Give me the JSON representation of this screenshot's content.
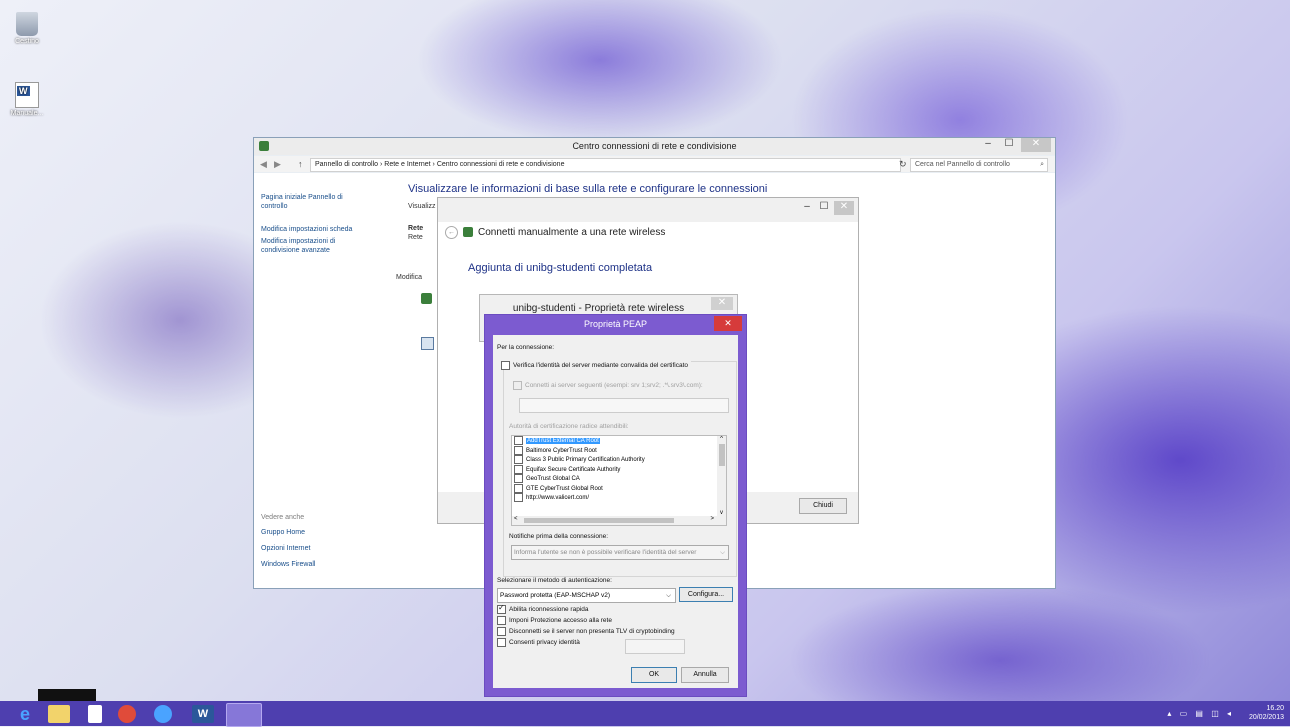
{
  "desktop": {
    "icons": [
      {
        "label": "Cestino"
      },
      {
        "label": "Manuale..."
      }
    ]
  },
  "main_window": {
    "title": "Centro connessioni di rete e condivisione",
    "breadcrumb": [
      "Pannello di controllo",
      "Rete e Internet",
      "Centro connessioni di rete e condivisione"
    ],
    "search_placeholder": "Cerca nel Pannello di controllo",
    "left_links": [
      "Pagina iniziale Pannello di controllo",
      "Modifica impostazioni scheda",
      "Modifica impostazioni di condivisione avanzate"
    ],
    "see_also_label": "Vedere anche",
    "see_also": [
      "Gruppo Home",
      "Opzioni Internet",
      "Windows Firewall"
    ],
    "heading": "Visualizzare le informazioni di base sulla rete e configurare le connessioni",
    "visualizza": "Visualizz",
    "rete_bold": "Rete",
    "rete": "Rete",
    "modifica": "Modifica"
  },
  "wireless_window": {
    "title": "Connetti manualmente a una rete wireless",
    "message": "Aggiunta di unibg-studenti completata",
    "close_button": "Chiudi"
  },
  "props_window": {
    "title": "unibg-studenti - Proprietà rete wireless"
  },
  "peap": {
    "title": "Proprietà PEAP",
    "connection_label": "Per la connessione:",
    "verify_label": "Verifica l'identità del server mediante convalida del certificato",
    "connect_servers_label": "Connetti ai server seguenti (esempi: srv 1;srv2; .*\\.srv3\\.com):",
    "ca_label": "Autorità di certificazione radice attendibili:",
    "ca_list": [
      "AddTrust External CA Root",
      "Baltimore CyberTrust Root",
      "Class 3 Public Primary Certification Authority",
      "Equifax Secure Certificate Authority",
      "GeoTrust Global CA",
      "GTE CyberTrust Global Root",
      "http://www.valicert.com/"
    ],
    "notify_label": "Notifiche prima della connessione:",
    "notify_value": "Informa l'utente se non è possibile verificare l'identità del server",
    "auth_label": "Selezionare il metodo di autenticazione:",
    "auth_value": "Password protetta (EAP-MSCHAP v2)",
    "configure_button": "Configura...",
    "options": [
      {
        "label": "Abilita riconnessione rapida",
        "checked": true
      },
      {
        "label": "Imponi Protezione accesso alla rete",
        "checked": false
      },
      {
        "label": "Disconnetti se il server non presenta TLV di cryptobinding",
        "checked": false
      },
      {
        "label": "Consenti privacy identità",
        "checked": false
      }
    ],
    "ok_button": "OK",
    "cancel_button": "Annulla"
  },
  "taskbar": {
    "time": "16.20",
    "date": "20/02/2013"
  },
  "colors": {
    "taskbar": "#4e3faf",
    "peap_frame": "#7c5bd0",
    "close_red": "#d63b3b",
    "link_blue": "#1a4f8b",
    "heading_blue": "#1e3287"
  }
}
